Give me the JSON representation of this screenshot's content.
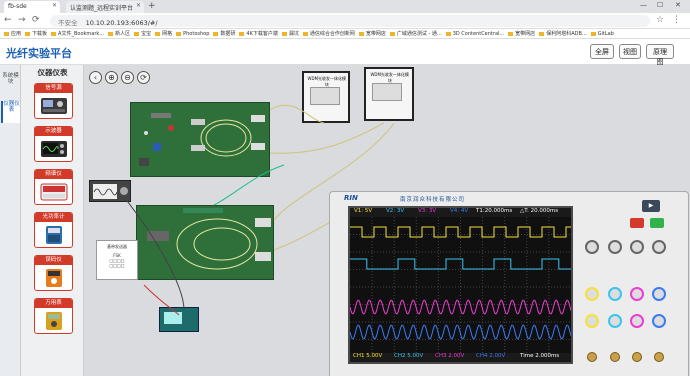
{
  "browser": {
    "tabs": [
      {
        "label": "fb-sde"
      },
      {
        "label": "认监测题_远程实训平台"
      }
    ],
    "new_tab": "+",
    "window_controls": [
      "—",
      "☐",
      "✕"
    ],
    "security_label": "不安全",
    "url": "10.10.20.193:6063/#/",
    "bookmarks": [
      "应用",
      "下载板",
      "A文件_Bookmark...",
      "新人区",
      "宝宝",
      "网格",
      "Photoshop",
      "数据研",
      "4K下载客户端",
      "漏坑",
      "通信综合合作创新网",
      "宽带网店",
      "广域通信测试 - 通...",
      "3D ContentCentral...",
      "宽带网店",
      "保利阿塔科ADB...",
      "GitLab"
    ]
  },
  "app": {
    "title": "光纤实验平台",
    "header_buttons": [
      "全屏",
      "视图",
      "原理图"
    ]
  },
  "left_nav": [
    {
      "label": "系统模块"
    },
    {
      "label": "仪器仪表"
    }
  ],
  "instrument_panel": {
    "title": "仪器仪表",
    "cards": [
      {
        "label": "信号源"
      },
      {
        "label": "示波器"
      },
      {
        "label": "频谱仪"
      },
      {
        "label": "光功率计"
      },
      {
        "label": "误码仪"
      },
      {
        "label": "万用表"
      }
    ]
  },
  "toolbar": {
    "icons": [
      "back-icon",
      "zoom-in-icon",
      "zoom-out-icon",
      "reset-icon"
    ],
    "glyphs": [
      "‹",
      "⊕",
      "⊖",
      "⟳"
    ]
  },
  "workspace": {
    "module_1_title": "WDM光收发一体化模块",
    "module_2_title": "WDM光收发一体化模块",
    "front_panel": {
      "title": "基带发送器",
      "rows": [
        "FSK",
        "□□□□",
        "□□□□"
      ]
    }
  },
  "oscilloscope": {
    "brand": "RIN",
    "maker": "南京润众科技有限公司",
    "top_readout": [
      "V1: 5V",
      "V2: 3V",
      "V3: 3V",
      "V4: 4V",
      "T1:20.000ms",
      "△T: 20.000ms"
    ],
    "bottom_readout": {
      "ch1": "CH1  5.00V",
      "ch2": "CH2  5.00V",
      "ch3": "CH3  2.00V",
      "ch4": "CH4  2.00V",
      "time": "Time 2.000ms"
    },
    "channel_colors": {
      "ch1": "#f5e13a",
      "ch2": "#3bc4f0",
      "ch3": "#ef3bd3",
      "ch4": "#3a7bf5"
    },
    "run_label": "▶"
  }
}
